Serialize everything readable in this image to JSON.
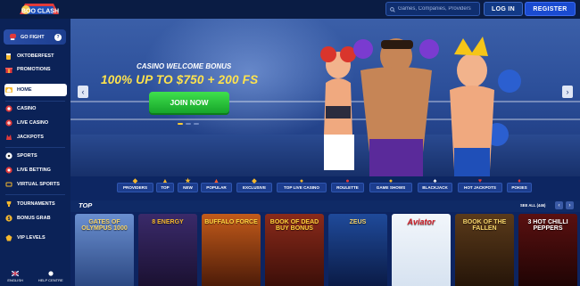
{
  "header": {
    "logo_text": "BOO CLASH",
    "search_placeholder": "Games, Companies, Providers",
    "login_label": "LOG IN",
    "register_label": "REGISTER"
  },
  "sidebar": {
    "fight_label": "GO FIGHT",
    "fight_badge": "?",
    "items": [
      {
        "label": "OKTOBERFEST",
        "icon": "beer-icon",
        "active": false
      },
      {
        "label": "PROMOTIONS",
        "icon": "gift-icon",
        "active": false
      },
      {
        "label": "HOME",
        "icon": "home-icon",
        "active": true
      },
      {
        "label": "CASINO",
        "icon": "chip-icon",
        "active": false
      },
      {
        "label": "LIVE CASINO",
        "icon": "live-casino-icon",
        "active": false
      },
      {
        "label": "JACKPOTS",
        "icon": "jackpot-icon",
        "active": false
      },
      {
        "label": "SPORTS",
        "icon": "soccer-ball-icon",
        "active": false
      },
      {
        "label": "LIVE BETTING",
        "icon": "live-betting-icon",
        "active": false
      },
      {
        "label": "VIRTUAL SPORTS",
        "icon": "virtual-sports-icon",
        "active": false
      },
      {
        "label": "TOURNAMENTS",
        "icon": "trophy-icon",
        "active": false
      },
      {
        "label": "BONUS GRAB",
        "icon": "bonus-grab-icon",
        "active": false
      },
      {
        "label": "VIP LEVELS",
        "icon": "vip-icon",
        "active": false
      }
    ],
    "bottom": {
      "language": "ENGLISH",
      "help": "HELP CENTRE"
    }
  },
  "banner": {
    "subtitle": "CASINO WELCOME BONUS",
    "headline": "100% UP TO $750 + 200 FS",
    "cta": "JOIN NOW",
    "slides": 3,
    "active_slide": 1
  },
  "categories": [
    {
      "label": "PROVIDERS",
      "icon": "providers-icon"
    },
    {
      "label": "TOP",
      "icon": "top-icon"
    },
    {
      "label": "NEW",
      "icon": "new-icon"
    },
    {
      "label": "POPULAR",
      "icon": "flame-icon"
    },
    {
      "label": "EXCLUSIVE",
      "icon": "exclusive-icon"
    },
    {
      "label": "TOP LIVE CASINO",
      "icon": "live-chip-icon"
    },
    {
      "label": "ROULETTE",
      "icon": "roulette-icon"
    },
    {
      "label": "GAME SHOWS",
      "icon": "game-shows-icon"
    },
    {
      "label": "BLACKJACK",
      "icon": "cards-icon"
    },
    {
      "label": "HOT JACKPOTS",
      "icon": "hot-jackpot-icon"
    },
    {
      "label": "POKIES",
      "icon": "pokies-icon"
    }
  ],
  "top_section": {
    "title": "TOP",
    "see_all": "SEE ALL (446)",
    "games": [
      {
        "name": "GATES OF OLYMPUS 1000",
        "bg": "#4a6fb0"
      },
      {
        "name": "8 ENERGY",
        "bg": "#2a1a4a"
      },
      {
        "name": "BUFFALO FORCE",
        "bg": "#7a2a10"
      },
      {
        "name": "BOOK OF DEAD BUY BONUS",
        "bg": "#6a1f16"
      },
      {
        "name": "ZEUS",
        "bg": "#0f2f6a"
      },
      {
        "name": "Aviator",
        "bg": "#e8eef5"
      },
      {
        "name": "BOOK OF THE FALLEN",
        "bg": "#3a2410"
      },
      {
        "name": "3 HOT CHILLI PEPPERS",
        "bg": "#3a0c0c"
      }
    ]
  },
  "colors": {
    "accent": "#1a4bd0",
    "cta": "#22b833",
    "promo": "#ffe34d",
    "background": "#0e2a63"
  }
}
